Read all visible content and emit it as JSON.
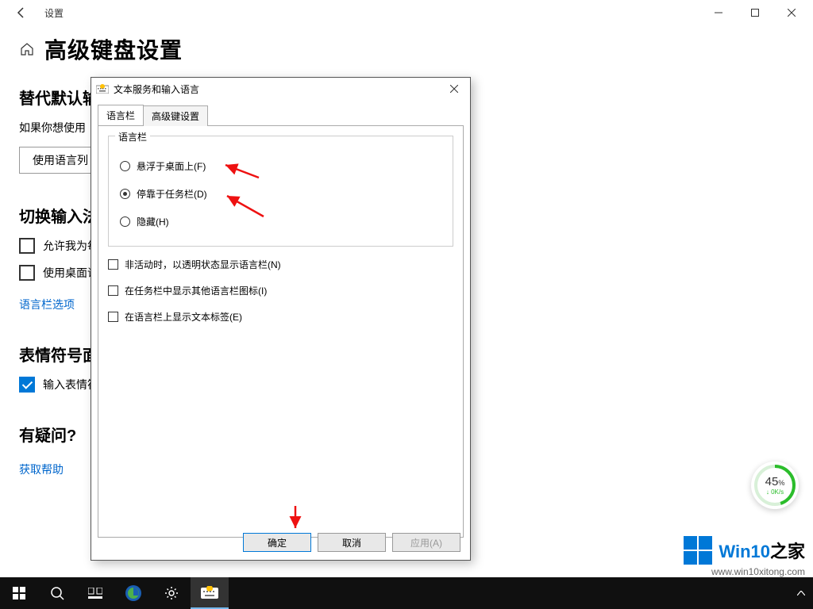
{
  "titlebar": {
    "title": "设置"
  },
  "page": {
    "title": "高级键盘设置",
    "section1_title": "替代默认输",
    "section1_body": "如果你想使用",
    "section1_button": "使用语言列",
    "section2_title": "切换输入法",
    "chk_allow": "允许我为每",
    "chk_desktop": "使用桌面语",
    "link_langbar": "语言栏选项",
    "section3_title": "表情符号面",
    "chk_emoji": "输入表情符",
    "section4_title": "有疑问?",
    "link_help": "获取帮助"
  },
  "dialog": {
    "title": "文本服务和输入语言",
    "tab_langbar": "语言栏",
    "tab_advanced": "高级键设置",
    "group_title": "语言栏",
    "radio_float": "悬浮于桌面上(F)",
    "radio_dock": "停靠于任务栏(D)",
    "radio_hide": "隐藏(H)",
    "chk_transparent": "非活动时，以透明状态显示语言栏(N)",
    "chk_extra_icons": "在任务栏中显示其他语言栏图标(I)",
    "chk_text_labels": "在语言栏上显示文本标签(E)",
    "btn_ok": "确定",
    "btn_cancel": "取消",
    "btn_apply": "应用(A)"
  },
  "widget": {
    "percent": "45",
    "unit": "%",
    "speed": "0K/s"
  },
  "watermark": {
    "brand1": "Win10",
    "brand2": "之家",
    "url": "www.win10xitong.com"
  }
}
